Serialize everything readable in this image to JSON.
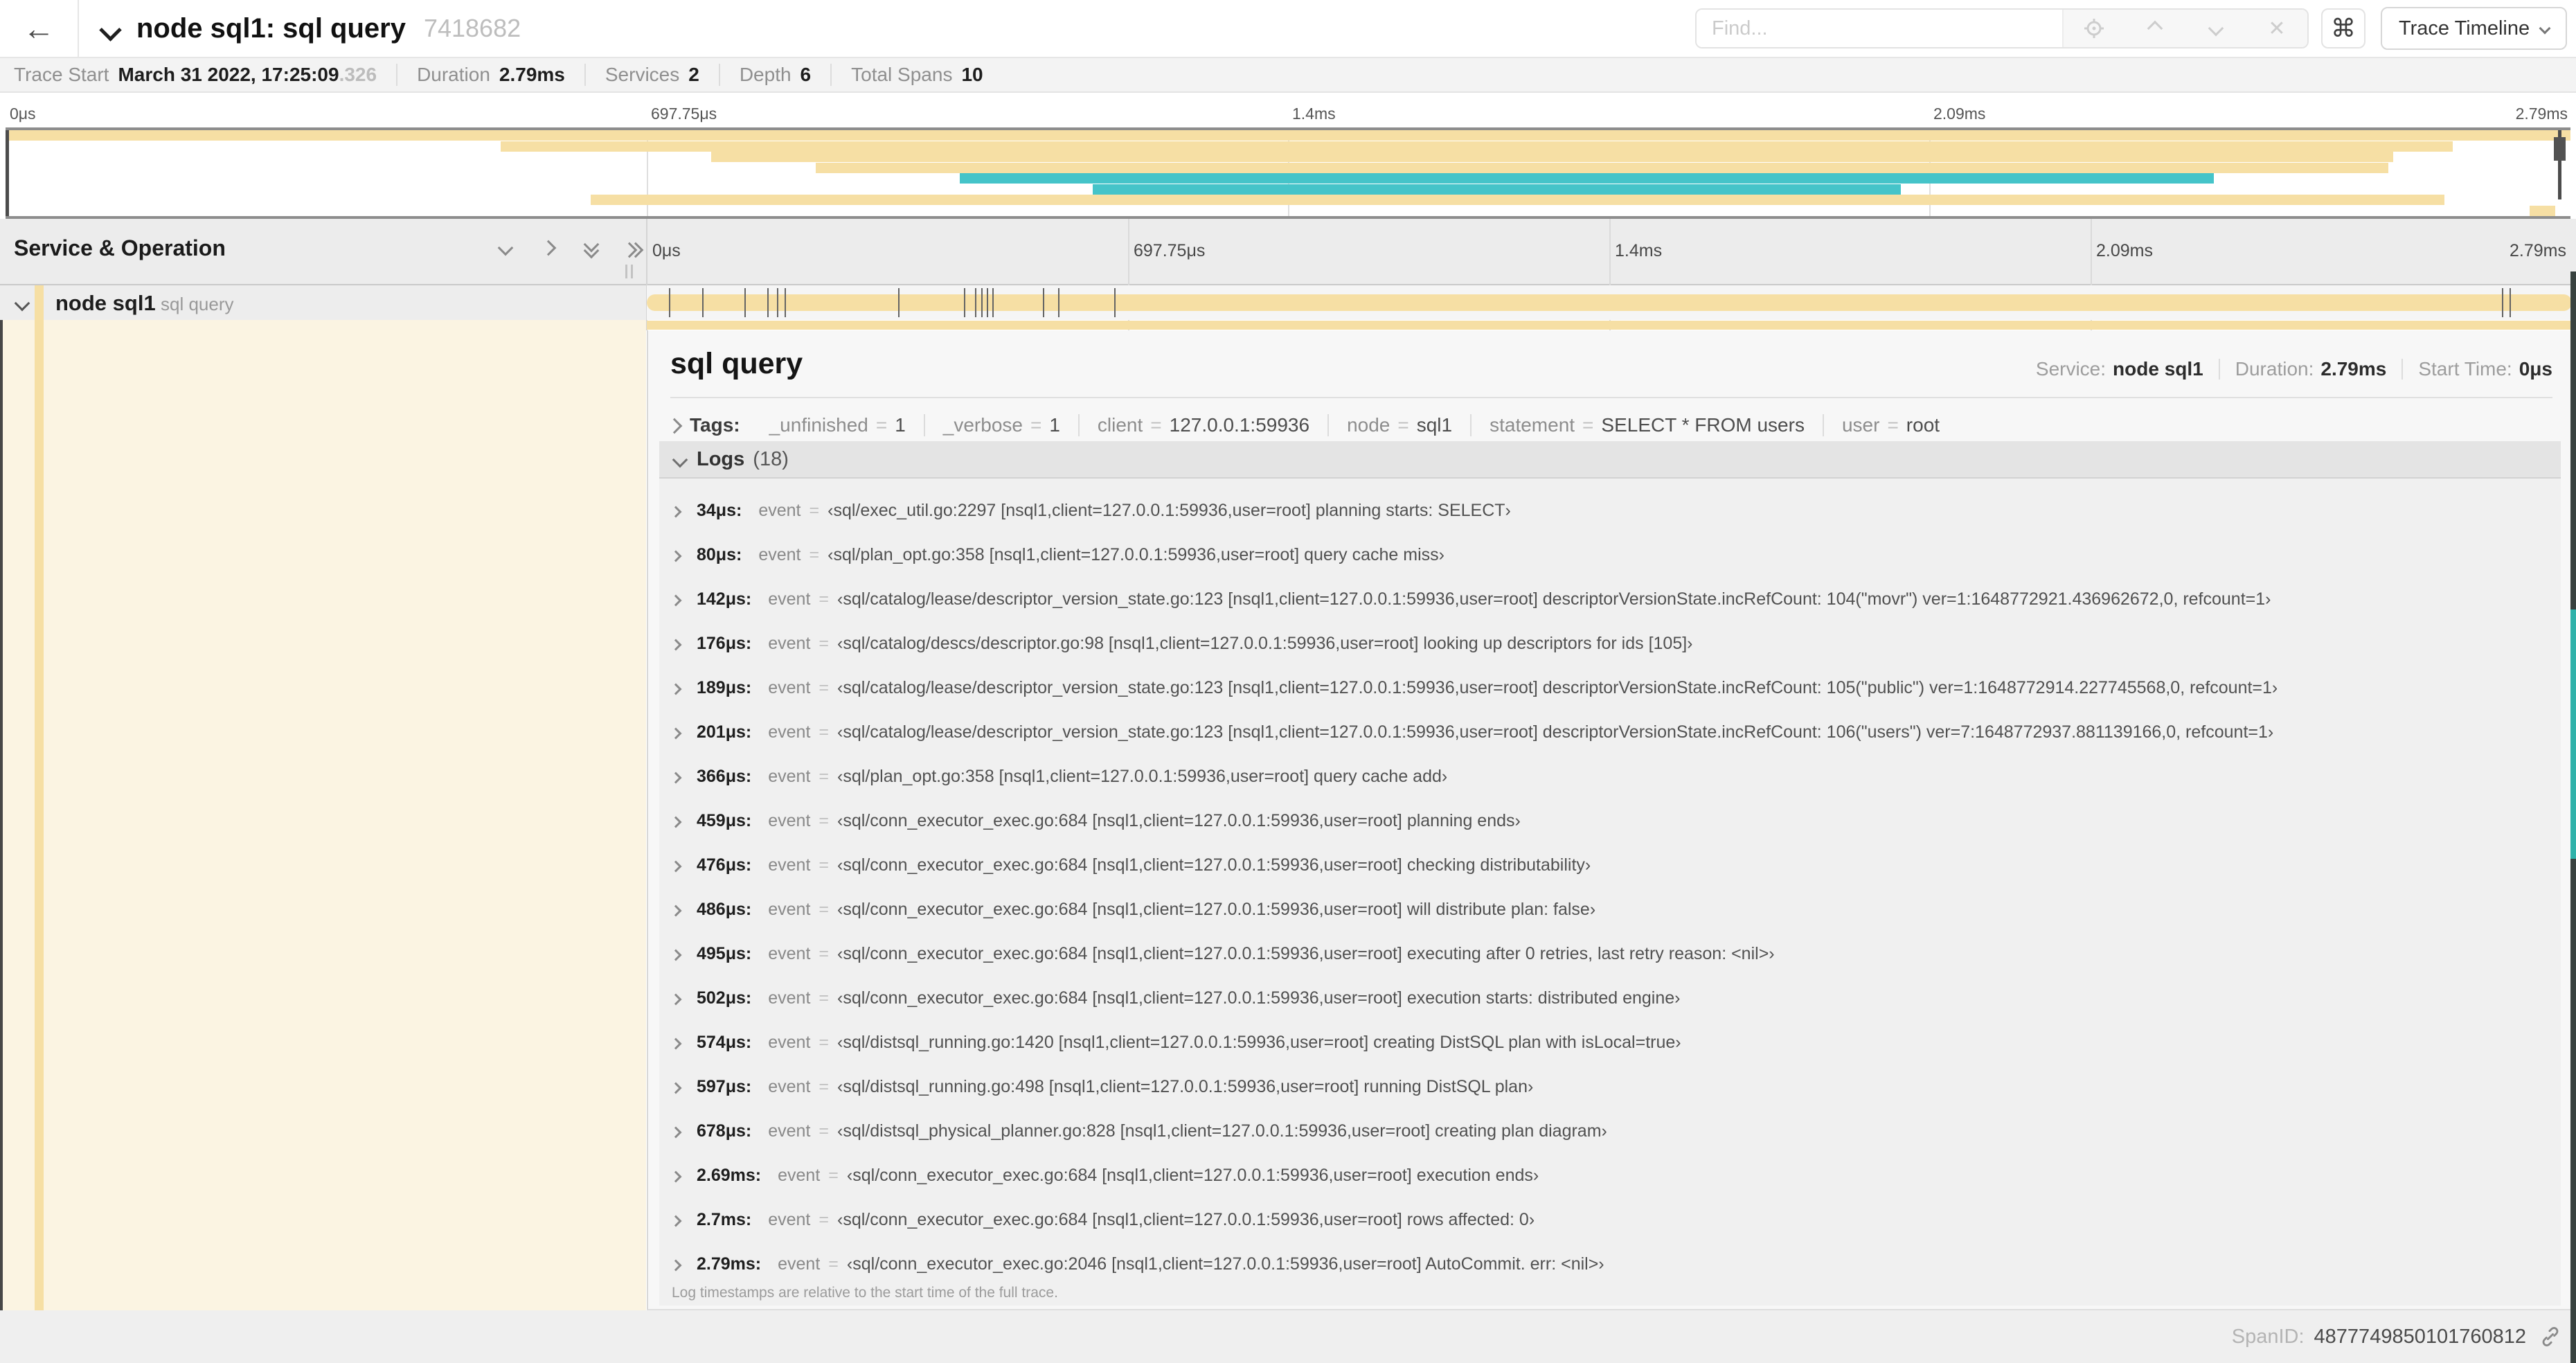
{
  "header": {
    "back_icon": "←",
    "title": "node sql1: sql query",
    "trace_id": "7418682",
    "find_placeholder": "Find...",
    "shortcut_key": "⌘",
    "view_button": "Trace Timeline"
  },
  "trace_info": {
    "items": [
      {
        "label": "Trace Start",
        "value": "March 31 2022, 17:25:09",
        "suffix": ".326"
      },
      {
        "label": "Duration",
        "value": "2.79ms"
      },
      {
        "label": "Services",
        "value": "2"
      },
      {
        "label": "Depth",
        "value": "6"
      },
      {
        "label": "Total Spans",
        "value": "10"
      }
    ]
  },
  "minimap": {
    "ticks": [
      "0μs",
      "697.75μs",
      "1.4ms",
      "2.09ms",
      "2.79ms"
    ],
    "tick_positions_pct": [
      0,
      25,
      50,
      75,
      100
    ],
    "bars": [
      {
        "row": 0,
        "start_pct": 0,
        "end_pct": 100,
        "color": "tan"
      },
      {
        "row": 1,
        "start_pct": 19.3,
        "end_pct": 95.4,
        "color": "tan"
      },
      {
        "row": 2,
        "start_pct": 27.5,
        "end_pct": 93.1,
        "color": "tan"
      },
      {
        "row": 3,
        "start_pct": 31.6,
        "end_pct": 92.9,
        "color": "tan"
      },
      {
        "row": 4,
        "start_pct": 37.2,
        "end_pct": 86.1,
        "color": "teal"
      },
      {
        "row": 5,
        "start_pct": 42.4,
        "end_pct": 73.9,
        "color": "teal"
      },
      {
        "row": 6,
        "start_pct": 22.8,
        "end_pct": 95.1,
        "color": "tan"
      },
      {
        "row": 7,
        "start_pct": 98.4,
        "end_pct": 99.4,
        "color": "tan"
      }
    ]
  },
  "timeline": {
    "left_header": "Service & Operation",
    "ticks": [
      "0μs",
      "697.75μs",
      "1.4ms",
      "2.09ms",
      "2.79ms"
    ],
    "tick_positions_pct": [
      0,
      25,
      50,
      75,
      100
    ],
    "row": {
      "service": "node sql1",
      "operation": "sql query"
    },
    "log_marker_pcts": [
      1.2,
      2.9,
      5.1,
      6.3,
      6.8,
      7.2,
      13.1,
      16.5,
      17.1,
      17.4,
      17.7,
      18,
      20.6,
      21.4,
      24.3,
      96.4,
      96.8,
      100
    ]
  },
  "colors": {
    "span_tan": "#F6DFA4",
    "span_teal": "#45C4C9",
    "left_column_cream": "#FBF4E2"
  },
  "detail": {
    "title": "sql query",
    "meta": [
      {
        "label": "Service:",
        "value": "node sql1"
      },
      {
        "label": "Duration:",
        "value": "2.79ms"
      },
      {
        "label": "Start Time:",
        "value": "0μs"
      }
    ],
    "tags": {
      "label": "Tags:",
      "eq": "=",
      "items": [
        {
          "key": "_unfinished",
          "value": "1"
        },
        {
          "key": "_verbose",
          "value": "1"
        },
        {
          "key": "client",
          "value": "127.0.0.1:59936"
        },
        {
          "key": "node",
          "value": "sql1"
        },
        {
          "key": "statement",
          "value": "SELECT * FROM users"
        },
        {
          "key": "user",
          "value": "root"
        }
      ]
    },
    "logs": {
      "label": "Logs",
      "count": "(18)",
      "event_key": "event",
      "eq": "=",
      "rows": [
        {
          "time": "34μs:",
          "value": "‹sql/exec_util.go:2297 [nsql1,client=127.0.0.1:59936,user=root] planning starts: SELECT›"
        },
        {
          "time": "80μs:",
          "value": "‹sql/plan_opt.go:358 [nsql1,client=127.0.0.1:59936,user=root] query cache miss›"
        },
        {
          "time": "142μs:",
          "value": "‹sql/catalog/lease/descriptor_version_state.go:123 [nsql1,client=127.0.0.1:59936,user=root] descriptorVersionState.incRefCount: 104(\"movr\") ver=1:1648772921.436962672,0, refcount=1›"
        },
        {
          "time": "176μs:",
          "value": "‹sql/catalog/descs/descriptor.go:98 [nsql1,client=127.0.0.1:59936,user=root] looking up descriptors for ids [105]›"
        },
        {
          "time": "189μs:",
          "value": "‹sql/catalog/lease/descriptor_version_state.go:123 [nsql1,client=127.0.0.1:59936,user=root] descriptorVersionState.incRefCount: 105(\"public\") ver=1:1648772914.227745568,0, refcount=1›"
        },
        {
          "time": "201μs:",
          "value": "‹sql/catalog/lease/descriptor_version_state.go:123 [nsql1,client=127.0.0.1:59936,user=root] descriptorVersionState.incRefCount: 106(\"users\") ver=7:1648772937.881139166,0, refcount=1›"
        },
        {
          "time": "366μs:",
          "value": "‹sql/plan_opt.go:358 [nsql1,client=127.0.0.1:59936,user=root] query cache add›"
        },
        {
          "time": "459μs:",
          "value": "‹sql/conn_executor_exec.go:684 [nsql1,client=127.0.0.1:59936,user=root] planning ends›"
        },
        {
          "time": "476μs:",
          "value": "‹sql/conn_executor_exec.go:684 [nsql1,client=127.0.0.1:59936,user=root] checking distributability›"
        },
        {
          "time": "486μs:",
          "value": "‹sql/conn_executor_exec.go:684 [nsql1,client=127.0.0.1:59936,user=root] will distribute plan: false›"
        },
        {
          "time": "495μs:",
          "value": "‹sql/conn_executor_exec.go:684 [nsql1,client=127.0.0.1:59936,user=root] executing after 0 retries, last retry reason: <nil>›"
        },
        {
          "time": "502μs:",
          "value": "‹sql/conn_executor_exec.go:684 [nsql1,client=127.0.0.1:59936,user=root] execution starts: distributed engine›"
        },
        {
          "time": "574μs:",
          "value": "‹sql/distsql_running.go:1420 [nsql1,client=127.0.0.1:59936,user=root] creating DistSQL plan with isLocal=true›"
        },
        {
          "time": "597μs:",
          "value": "‹sql/distsql_running.go:498 [nsql1,client=127.0.0.1:59936,user=root] running DistSQL plan›"
        },
        {
          "time": "678μs:",
          "value": "‹sql/distsql_physical_planner.go:828 [nsql1,client=127.0.0.1:59936,user=root] creating plan diagram›"
        },
        {
          "time": "2.69ms:",
          "value": "‹sql/conn_executor_exec.go:684 [nsql1,client=127.0.0.1:59936,user=root] execution ends›"
        },
        {
          "time": "2.7ms:",
          "value": "‹sql/conn_executor_exec.go:684 [nsql1,client=127.0.0.1:59936,user=root] rows affected: 0›"
        },
        {
          "time": "2.79ms:",
          "value": "‹sql/conn_executor_exec.go:2046 [nsql1,client=127.0.0.1:59936,user=root] AutoCommit. err: <nil>›"
        }
      ],
      "note": "Log timestamps are relative to the start time of the full trace."
    },
    "span_id_label": "SpanID:",
    "span_id": "4877749850101760812"
  }
}
